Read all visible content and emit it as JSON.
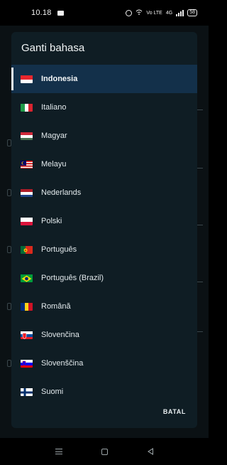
{
  "status_bar": {
    "time": "10.18",
    "net_label": "Vo LTE",
    "signal_label": "4G",
    "battery": "58",
    "icons": [
      "message-icon",
      "alarm-icon",
      "wifi-icon",
      "signal-icon",
      "battery-icon"
    ]
  },
  "dialog": {
    "title": "Ganti bahasa",
    "cancel_label": "BATAL",
    "languages": [
      {
        "label": "Indonesia",
        "flag": "flag-indonesia-icon",
        "selected": true
      },
      {
        "label": "Italiano",
        "flag": "flag-italy-icon",
        "selected": false
      },
      {
        "label": "Magyar",
        "flag": "flag-hungary-icon",
        "selected": false
      },
      {
        "label": "Melayu",
        "flag": "flag-malaysia-icon",
        "selected": false
      },
      {
        "label": "Nederlands",
        "flag": "flag-netherlands-icon",
        "selected": false
      },
      {
        "label": "Polski",
        "flag": "flag-poland-icon",
        "selected": false
      },
      {
        "label": "Português",
        "flag": "flag-portugal-icon",
        "selected": false
      },
      {
        "label": "Português (Brazil)",
        "flag": "flag-brazil-icon",
        "selected": false
      },
      {
        "label": "Română",
        "flag": "flag-romania-icon",
        "selected": false
      },
      {
        "label": "Slovenčina",
        "flag": "flag-slovakia-icon",
        "selected": false
      },
      {
        "label": "Slovenščina",
        "flag": "flag-slovenia-icon",
        "selected": false
      },
      {
        "label": "Suomi",
        "flag": "flag-finland-icon",
        "selected": false
      }
    ]
  },
  "colors": {
    "dialog_bg": "#0f1d24",
    "selected_row": "#13304a",
    "page_bg": "#0b1114"
  }
}
